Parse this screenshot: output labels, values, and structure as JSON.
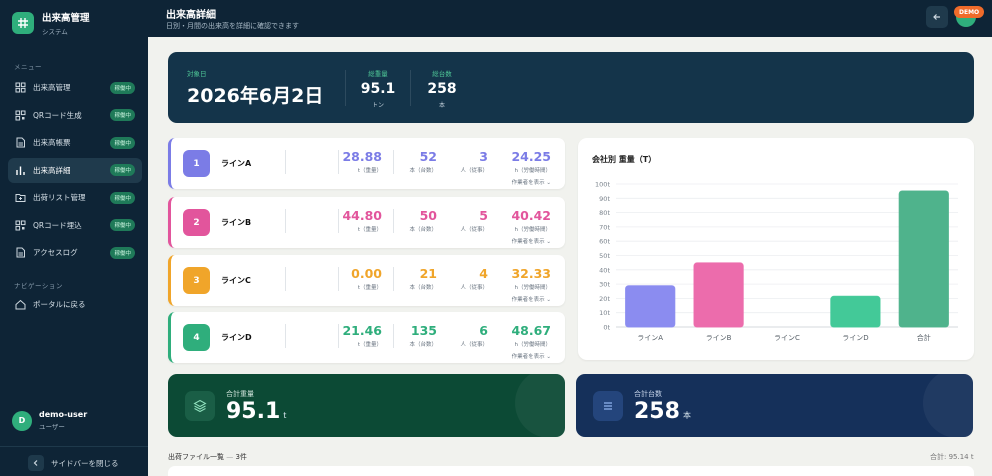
{
  "sidebar": {
    "brand_title": "出来高管理",
    "brand_sub": "システム",
    "menu_label": "メニュー",
    "nav_label": "ナビゲーション",
    "items": [
      {
        "label": "出来高管理",
        "badge": "稼働中",
        "icon": "grid-icon"
      },
      {
        "label": "QRコード生成",
        "badge": "稼働中",
        "icon": "qr-icon"
      },
      {
        "label": "出来高帳票",
        "badge": "稼働中",
        "icon": "document-icon"
      },
      {
        "label": "出来高詳細",
        "badge": "稼働中",
        "icon": "bar-chart-icon"
      },
      {
        "label": "出荷リスト管理",
        "badge": "稼働中",
        "icon": "folder-icon"
      },
      {
        "label": "QRコード埋込",
        "badge": "稼働中",
        "icon": "qr-icon"
      },
      {
        "label": "アクセスログ",
        "badge": "稼働中",
        "icon": "document-icon"
      }
    ],
    "portal_label": "ポータルに戻る",
    "user_initial": "D",
    "user_name": "demo-user",
    "user_role": "ユーザー",
    "collapse_label": "サイドバーを閉じる"
  },
  "header": {
    "title": "出来高詳細",
    "subtitle": "日別・月間の出来高を詳細に確認できます",
    "demo_badge": "DEMO"
  },
  "summary": {
    "date_label": "対象日",
    "date": "2026年6月2日",
    "weight_label": "総重量",
    "weight": "95.1",
    "weight_unit": "トン",
    "count_label": "総台数",
    "count": "258",
    "count_unit": "本"
  },
  "lines": [
    {
      "num": "1",
      "name": "ラインA",
      "color": "#7b7ce6",
      "weight": "28.88",
      "count": "52",
      "workers": "3",
      "hours": "24.25"
    },
    {
      "num": "2",
      "name": "ラインB",
      "color": "#e2559c",
      "weight": "44.80",
      "count": "50",
      "workers": "5",
      "hours": "40.42"
    },
    {
      "num": "3",
      "name": "ラインC",
      "color": "#f0a52a",
      "weight": "0.00",
      "count": "21",
      "workers": "4",
      "hours": "32.33"
    },
    {
      "num": "4",
      "name": "ラインD",
      "color": "#2fae7c",
      "weight": "21.46",
      "count": "135",
      "workers": "6",
      "hours": "48.67"
    }
  ],
  "line_units": {
    "weight": "t（重量）",
    "count": "本（台数）",
    "workers": "人（従事）",
    "hours": "h（労働時間）",
    "show_workers": "作業者を表示"
  },
  "chart_data": {
    "type": "bar",
    "title": "会社別 重量（T）",
    "categories": [
      "ラインA",
      "ラインB",
      "ラインC",
      "ラインD",
      "合計"
    ],
    "values": [
      28.88,
      44.8,
      0,
      21.46,
      95.14
    ],
    "colors": [
      "#8b8cf0",
      "#ec6cac",
      "#f0a52a",
      "#43c998",
      "#4fb38c"
    ],
    "ylim": [
      0,
      100
    ],
    "yticks": [
      "0t",
      "10t",
      "20t",
      "30t",
      "40t",
      "50t",
      "60t",
      "70t",
      "80t",
      "90t",
      "100t"
    ],
    "grid": true
  },
  "totals": {
    "weight_label": "合計重量",
    "weight": "95.1",
    "weight_unit": "t",
    "count_label": "合計台数",
    "count": "258",
    "count_unit": "本"
  },
  "files": {
    "header_prefix": "出荷ファイル一覧",
    "header_sep": "—",
    "header_count": "3件",
    "total": "合計: 95.14 t"
  }
}
